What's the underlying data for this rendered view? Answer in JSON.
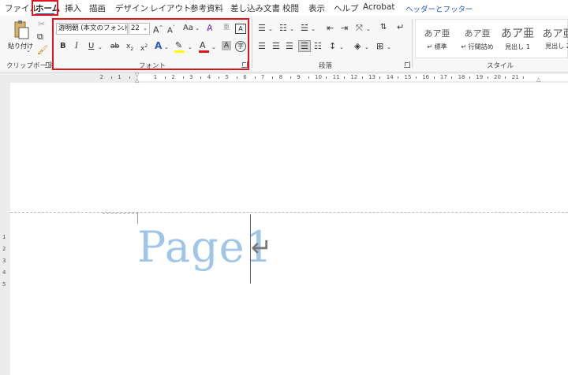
{
  "tabs": [
    {
      "label": "ファイル",
      "active": false
    },
    {
      "label": "ホーム",
      "active": true
    },
    {
      "label": "挿入",
      "active": false
    },
    {
      "label": "描画",
      "active": false
    },
    {
      "label": "デザイン",
      "active": false
    },
    {
      "label": "レイアウト",
      "active": false
    },
    {
      "label": "参考資料",
      "active": false
    },
    {
      "label": "差し込み文書",
      "active": false
    },
    {
      "label": "校閲",
      "active": false
    },
    {
      "label": "表示",
      "active": false
    },
    {
      "label": "ヘルプ",
      "active": false
    },
    {
      "label": "Acrobat",
      "active": false
    },
    {
      "label": "ヘッダーとフッター",
      "active": false,
      "contextual": true
    }
  ],
  "clipboard": {
    "paste_label": "貼り付け",
    "group_label": "クリップボード"
  },
  "font": {
    "font_name": "游明朝 (本文のフォント",
    "font_size": "22",
    "group_label": "フォント",
    "case_label": "Aa"
  },
  "paragraph": {
    "group_label": "段落"
  },
  "styles": {
    "group_label": "スタイル",
    "items": [
      {
        "preview": "あア亜",
        "name": "↵ 標準"
      },
      {
        "preview": "あア亜",
        "name": "↵ 行間詰め"
      },
      {
        "preview": "あア亜",
        "name": "見出し 1"
      },
      {
        "preview": "あア亜",
        "name": "見出し 2"
      }
    ]
  },
  "ruler": {
    "numbers": [
      "2",
      "1",
      "1",
      "2",
      "3",
      "4",
      "5",
      "6",
      "7",
      "8",
      "9",
      "10",
      "11",
      "12",
      "13",
      "14",
      "15",
      "16",
      "17",
      "18",
      "19",
      "20",
      "21"
    ]
  },
  "vertical_ruler": {
    "numbers": [
      "1",
      "2",
      "3",
      "4",
      "5"
    ]
  },
  "document": {
    "header_text": "Page1",
    "paragraph_mark": "↵"
  },
  "colors": {
    "accent": "#1a5fb4",
    "highlight_frame": "#e0141e",
    "header_text_color": "#9fc5e8"
  }
}
